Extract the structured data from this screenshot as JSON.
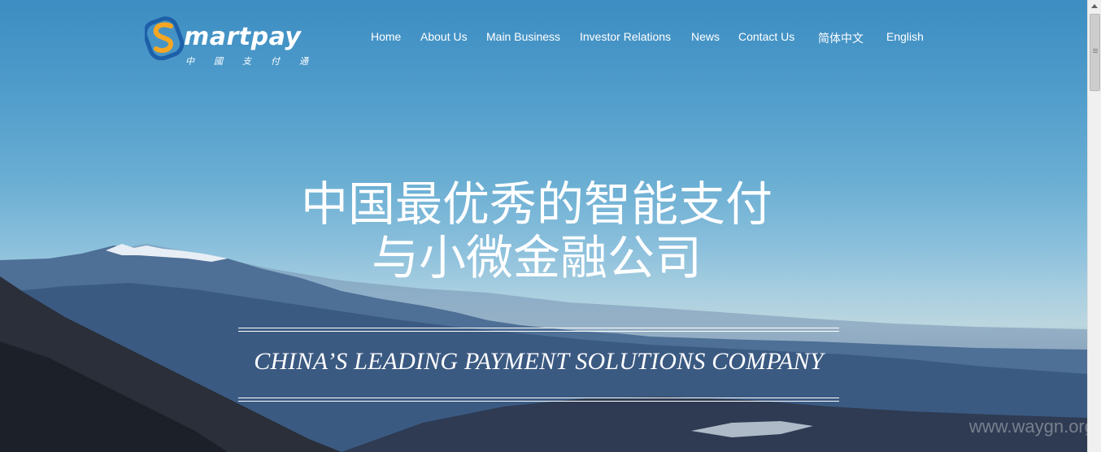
{
  "brand": {
    "word": "martpay",
    "sub": "中國支付通",
    "colors": {
      "orange": "#f5a623",
      "blue": "#1d5fa8"
    }
  },
  "nav": {
    "items": [
      {
        "label": "Home"
      },
      {
        "label": "About Us"
      },
      {
        "label": "Main Business"
      },
      {
        "label": "Investor Relations"
      },
      {
        "label": "News"
      },
      {
        "label": "Contact Us"
      },
      {
        "label": "简体中文"
      },
      {
        "label": "English"
      }
    ]
  },
  "hero": {
    "headline_line1": "中国最优秀的智能支付",
    "headline_line2": "与小微金融公司",
    "tagline": "CHINA’S LEADING PAYMENT SOLUTIONS COMPANY"
  },
  "watermark": "www.waygn.org"
}
